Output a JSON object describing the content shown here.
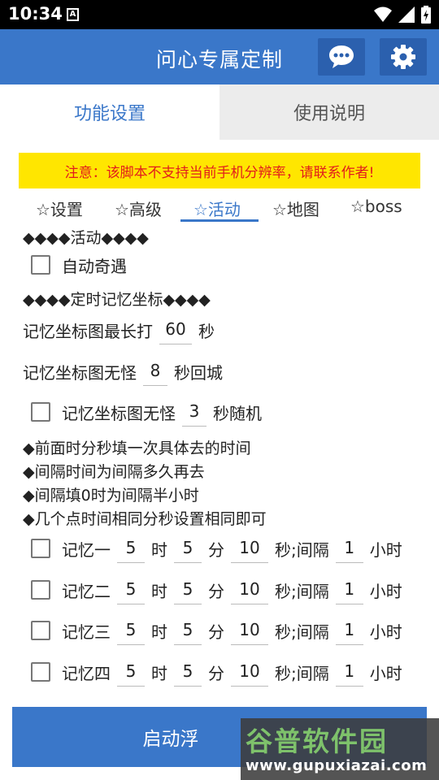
{
  "status_bar": {
    "time": "10:34",
    "notification_icon_letter": "A"
  },
  "app_bar": {
    "title": "问心专属定制",
    "message_icon": "chat-bubble-icon",
    "settings_icon": "gear-icon"
  },
  "tabs": [
    {
      "label": "功能设置",
      "active": true
    },
    {
      "label": "使用说明",
      "active": false
    }
  ],
  "notice": "注意：该脚本不支持当前手机分辨率，请联系作者!",
  "sub_tabs": [
    "☆设置",
    "☆高级",
    "☆活动",
    "☆地图",
    "☆boss"
  ],
  "sub_tab_active_index": 2,
  "section_activity": "◆◆◆◆活动◆◆◆◆",
  "auto_encounter_label": "自动奇遇",
  "section_timer": "◆◆◆◆定时记忆坐标◆◆◆◆",
  "max_fight": {
    "label": "记忆坐标图最长打",
    "value": "60",
    "unit": "秒"
  },
  "no_monster_return": {
    "label": "记忆坐标图无怪",
    "value": "8",
    "unit": "秒回城"
  },
  "no_monster_random": {
    "label": "记忆坐标图无怪",
    "value": "3",
    "unit": "秒随机"
  },
  "tips": [
    "◆前面时分秒填一次具体去的时间",
    "◆间隔时间为间隔多久再去",
    "◆间隔填0时为间隔半小时",
    "◆几个点时间相同分秒设置相同即可"
  ],
  "units": {
    "hour": "时",
    "minute": "分",
    "second_interval": "秒;间隔",
    "hours": "小时"
  },
  "memories": [
    {
      "label": "记忆一",
      "hour": "5",
      "minute": "5",
      "second": "10",
      "interval": "1"
    },
    {
      "label": "记忆二",
      "hour": "5",
      "minute": "5",
      "second": "10",
      "interval": "1"
    },
    {
      "label": "记忆三",
      "hour": "5",
      "minute": "5",
      "second": "10",
      "interval": "1"
    },
    {
      "label": "记忆四",
      "hour": "5",
      "minute": "5",
      "second": "10",
      "interval": "1"
    }
  ],
  "start_button": "启动浮",
  "watermark": {
    "logo": "谷普软件园",
    "url": "www.gupuxiazai.com"
  }
}
